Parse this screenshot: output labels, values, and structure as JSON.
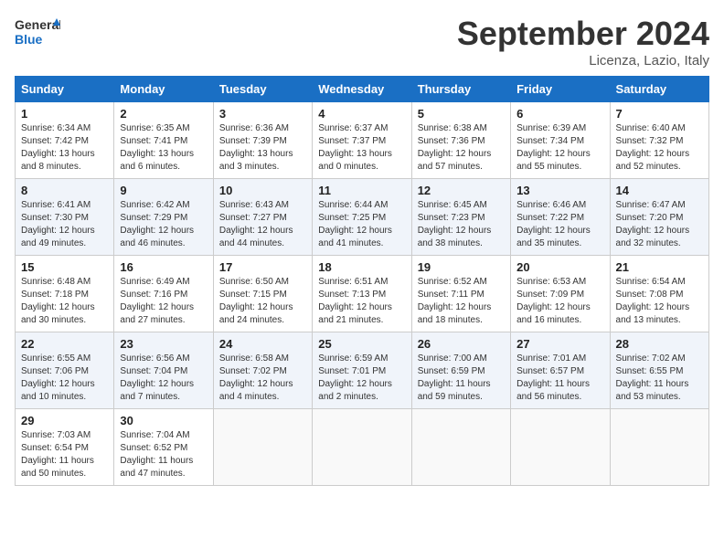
{
  "logo": {
    "line1": "General",
    "line2": "Blue"
  },
  "title": "September 2024",
  "location": "Licenza, Lazio, Italy",
  "weekdays": [
    "Sunday",
    "Monday",
    "Tuesday",
    "Wednesday",
    "Thursday",
    "Friday",
    "Saturday"
  ],
  "weeks": [
    [
      {
        "day": "1",
        "info": "Sunrise: 6:34 AM\nSunset: 7:42 PM\nDaylight: 13 hours\nand 8 minutes."
      },
      {
        "day": "2",
        "info": "Sunrise: 6:35 AM\nSunset: 7:41 PM\nDaylight: 13 hours\nand 6 minutes."
      },
      {
        "day": "3",
        "info": "Sunrise: 6:36 AM\nSunset: 7:39 PM\nDaylight: 13 hours\nand 3 minutes."
      },
      {
        "day": "4",
        "info": "Sunrise: 6:37 AM\nSunset: 7:37 PM\nDaylight: 13 hours\nand 0 minutes."
      },
      {
        "day": "5",
        "info": "Sunrise: 6:38 AM\nSunset: 7:36 PM\nDaylight: 12 hours\nand 57 minutes."
      },
      {
        "day": "6",
        "info": "Sunrise: 6:39 AM\nSunset: 7:34 PM\nDaylight: 12 hours\nand 55 minutes."
      },
      {
        "day": "7",
        "info": "Sunrise: 6:40 AM\nSunset: 7:32 PM\nDaylight: 12 hours\nand 52 minutes."
      }
    ],
    [
      {
        "day": "8",
        "info": "Sunrise: 6:41 AM\nSunset: 7:30 PM\nDaylight: 12 hours\nand 49 minutes."
      },
      {
        "day": "9",
        "info": "Sunrise: 6:42 AM\nSunset: 7:29 PM\nDaylight: 12 hours\nand 46 minutes."
      },
      {
        "day": "10",
        "info": "Sunrise: 6:43 AM\nSunset: 7:27 PM\nDaylight: 12 hours\nand 44 minutes."
      },
      {
        "day": "11",
        "info": "Sunrise: 6:44 AM\nSunset: 7:25 PM\nDaylight: 12 hours\nand 41 minutes."
      },
      {
        "day": "12",
        "info": "Sunrise: 6:45 AM\nSunset: 7:23 PM\nDaylight: 12 hours\nand 38 minutes."
      },
      {
        "day": "13",
        "info": "Sunrise: 6:46 AM\nSunset: 7:22 PM\nDaylight: 12 hours\nand 35 minutes."
      },
      {
        "day": "14",
        "info": "Sunrise: 6:47 AM\nSunset: 7:20 PM\nDaylight: 12 hours\nand 32 minutes."
      }
    ],
    [
      {
        "day": "15",
        "info": "Sunrise: 6:48 AM\nSunset: 7:18 PM\nDaylight: 12 hours\nand 30 minutes."
      },
      {
        "day": "16",
        "info": "Sunrise: 6:49 AM\nSunset: 7:16 PM\nDaylight: 12 hours\nand 27 minutes."
      },
      {
        "day": "17",
        "info": "Sunrise: 6:50 AM\nSunset: 7:15 PM\nDaylight: 12 hours\nand 24 minutes."
      },
      {
        "day": "18",
        "info": "Sunrise: 6:51 AM\nSunset: 7:13 PM\nDaylight: 12 hours\nand 21 minutes."
      },
      {
        "day": "19",
        "info": "Sunrise: 6:52 AM\nSunset: 7:11 PM\nDaylight: 12 hours\nand 18 minutes."
      },
      {
        "day": "20",
        "info": "Sunrise: 6:53 AM\nSunset: 7:09 PM\nDaylight: 12 hours\nand 16 minutes."
      },
      {
        "day": "21",
        "info": "Sunrise: 6:54 AM\nSunset: 7:08 PM\nDaylight: 12 hours\nand 13 minutes."
      }
    ],
    [
      {
        "day": "22",
        "info": "Sunrise: 6:55 AM\nSunset: 7:06 PM\nDaylight: 12 hours\nand 10 minutes."
      },
      {
        "day": "23",
        "info": "Sunrise: 6:56 AM\nSunset: 7:04 PM\nDaylight: 12 hours\nand 7 minutes."
      },
      {
        "day": "24",
        "info": "Sunrise: 6:58 AM\nSunset: 7:02 PM\nDaylight: 12 hours\nand 4 minutes."
      },
      {
        "day": "25",
        "info": "Sunrise: 6:59 AM\nSunset: 7:01 PM\nDaylight: 12 hours\nand 2 minutes."
      },
      {
        "day": "26",
        "info": "Sunrise: 7:00 AM\nSunset: 6:59 PM\nDaylight: 11 hours\nand 59 minutes."
      },
      {
        "day": "27",
        "info": "Sunrise: 7:01 AM\nSunset: 6:57 PM\nDaylight: 11 hours\nand 56 minutes."
      },
      {
        "day": "28",
        "info": "Sunrise: 7:02 AM\nSunset: 6:55 PM\nDaylight: 11 hours\nand 53 minutes."
      }
    ],
    [
      {
        "day": "29",
        "info": "Sunrise: 7:03 AM\nSunset: 6:54 PM\nDaylight: 11 hours\nand 50 minutes."
      },
      {
        "day": "30",
        "info": "Sunrise: 7:04 AM\nSunset: 6:52 PM\nDaylight: 11 hours\nand 47 minutes."
      },
      {
        "day": "",
        "info": ""
      },
      {
        "day": "",
        "info": ""
      },
      {
        "day": "",
        "info": ""
      },
      {
        "day": "",
        "info": ""
      },
      {
        "day": "",
        "info": ""
      }
    ]
  ]
}
